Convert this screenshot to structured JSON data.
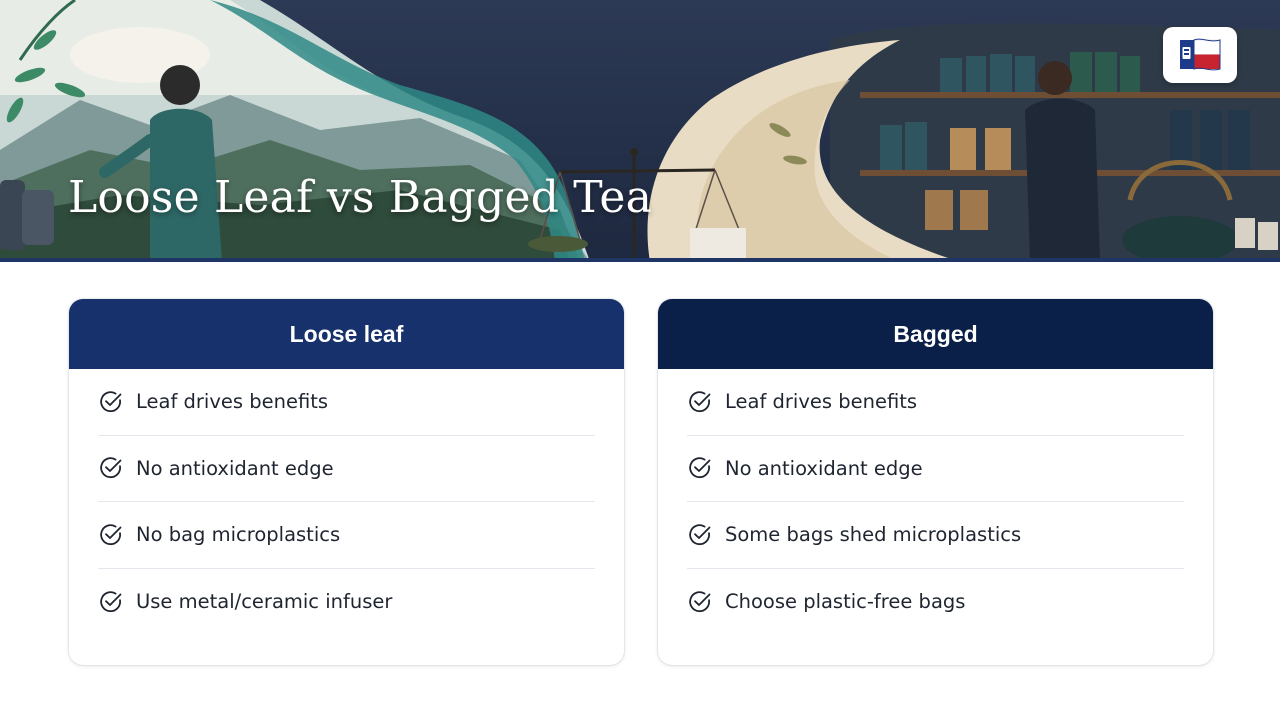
{
  "banner": {
    "title": "Loose Leaf vs Bagged Tea",
    "logo_icon": "flag-logo-icon"
  },
  "colors": {
    "left_header": "#16316b",
    "right_header": "#0b2048",
    "text": "#1f2530"
  },
  "columns": [
    {
      "title": "Loose leaf",
      "items": [
        "Leaf drives benefits",
        "No antioxidant edge",
        "No bag microplastics",
        "Use metal/ceramic infuser"
      ]
    },
    {
      "title": "Bagged",
      "items": [
        "Leaf drives benefits",
        "No antioxidant edge",
        "Some bags shed microplastics",
        "Choose plastic-free bags"
      ]
    }
  ]
}
